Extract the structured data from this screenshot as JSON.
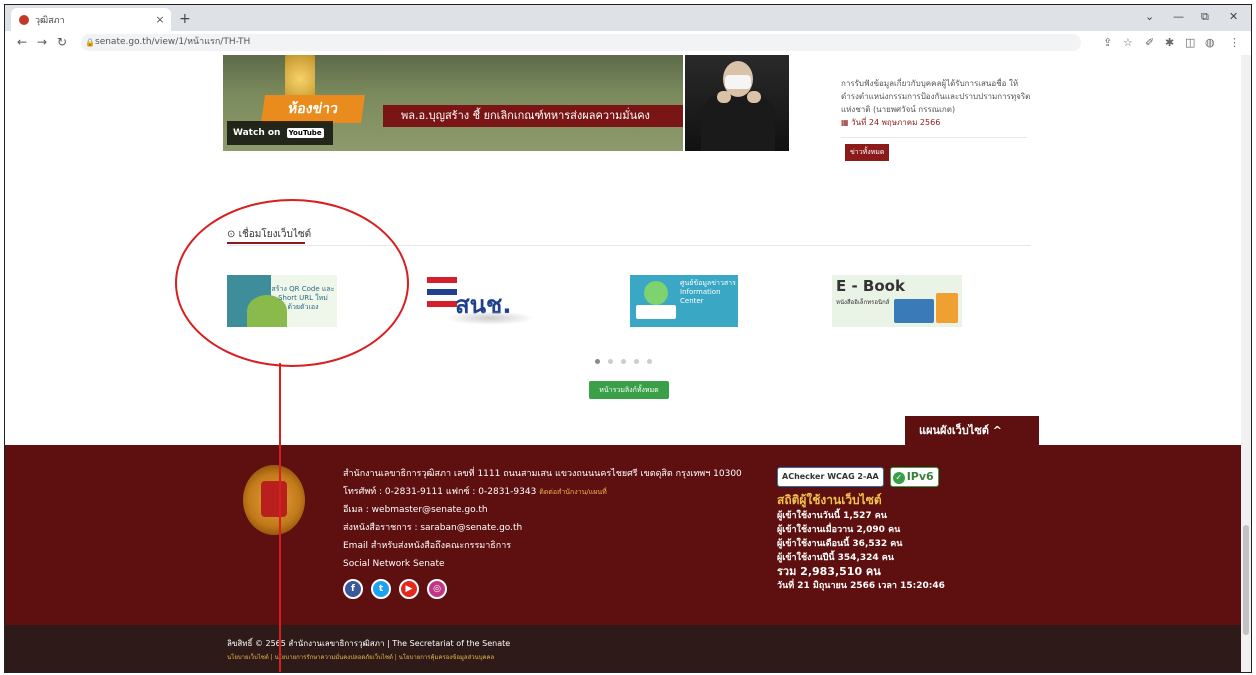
{
  "browser": {
    "tab_title": "วุฒิสภา",
    "tab_close": "×",
    "new_tab": "+",
    "url": "senate.go.th/view/1/หน้าแรก/TH-TH",
    "window_controls": [
      "⌄",
      "—",
      "⧉",
      "✕"
    ]
  },
  "video": {
    "room_label": "ห้องข่าว",
    "headline": "พล.อ.บุญสร้าง ชี้ ยกเลิกเกณฑ์ทหารส่งผลความมั่นคง",
    "watch_on": "Watch on",
    "youtube": "YouTube"
  },
  "news": {
    "item_text": "การรับฟังข้อมูลเกี่ยวกับบุคคลผู้ได้รับการเสนอชื่อ ให้ดำรงตำแหน่งกรรมการป้องกันและปราบปรามการทุจริตแห่งชาติ (นายพศวัจน์ กรรณเกต)",
    "item_date": "วันที่ 24 พฤษภาคม 2566",
    "all_news": "ข่าวทั้งหมด"
  },
  "links": {
    "heading": "เชื่อมโยงเว็บไซต์",
    "banners": [
      {
        "name": "qr-code",
        "text": "สร้าง QR Code และ Short URL ใหม่ ด้วยตัวเอง"
      },
      {
        "name": "snch",
        "text": "สนช."
      },
      {
        "name": "info-center",
        "text": "ศูนย์ข้อมูลข่าวสาร Information Center"
      },
      {
        "name": "ebook",
        "text": "E - Book",
        "sub": "หนังสืออิเล็กทรอนิกส์"
      }
    ],
    "carousel_dots": 5,
    "active_dot": 0,
    "all_button": "หน้ารวมลิงก์ทั้งหมด"
  },
  "sitemap_label": "แผนผังเว็บไซต์ ^",
  "footer": {
    "address": "สำนักงานเลขาธิการวุฒิสภา เลขที่ 1111 ถนนสามเสน แขวงถนนนครไชยศรี เขตดุสิต กรุงเทพฯ 10300",
    "phone": "โทรศัพท์ : 0-2831-9111 แฟกซ์ : 0-2831-9343",
    "phone_link": "ติดต่อสำนักงาน/แผนที่",
    "email": "อีเมล : webmaster@senate.go.th",
    "saraban": "ส่งหนังสือราชการ : saraban@senate.go.th",
    "email_committee": "Email สำหรับส่งหนังสือถึงคณะกรรมาธิการ",
    "social_heading": "Social Network Senate",
    "social": [
      {
        "name": "facebook-icon",
        "glyph": "f",
        "color": "#3b5998"
      },
      {
        "name": "twitter-icon",
        "glyph": "t",
        "color": "#1da1f2"
      },
      {
        "name": "youtube-icon",
        "glyph": "▶",
        "color": "#e02a20"
      },
      {
        "name": "instagram-icon",
        "glyph": "◎",
        "color": "#c13584"
      }
    ],
    "badges": {
      "achecker": "AChecker WCAG 2-AA",
      "ipv6": "IPv6"
    },
    "stats_heading": "สถิติผู้ใช้งานเว็บไซต์",
    "stats": [
      "ผู้เข้าใช้งานวันนี้ 1,527 คน",
      "ผู้เข้าใช้งานเมื่อวาน 2,090 คน",
      "ผู้เข้าใช้งานเดือนนี้ 36,532 คน",
      "ผู้เข้าใช้งานปีนี้ 354,324 คน"
    ],
    "total": "รวม 2,983,510 คน",
    "datetime": "วันที่ 21 มิถุนายน 2566 เวลา 15:20:46",
    "copyright": "ลิขสิทธิ์ © 2565 สำนักงานเลขาธิการวุฒิสภา | The Secretariat of the Senate",
    "bottom_links": "นโยบายเว็บไซต์ | นโยบายการรักษาความมั่นคงปลอดภัยเว็บไซต์ | นโยบายการคุ้มครองข้อมูลส่วนบุคคล"
  },
  "colors": {
    "footer_bg": "#5e1010",
    "footer_bottom": "#2e1a18",
    "accent": "#8b1a1a",
    "green_button": "#3aa047",
    "annotation": "#d81e1e"
  }
}
